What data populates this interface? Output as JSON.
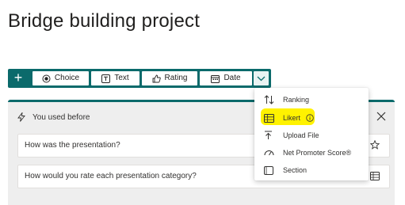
{
  "page": {
    "title": "Bridge building project"
  },
  "toolbar": {
    "add_label": "+",
    "choice_label": "Choice",
    "text_label": "Text",
    "rating_label": "Rating",
    "date_label": "Date"
  },
  "card": {
    "used_before_label": "You used before",
    "questions": [
      "How was the presentation?",
      "How would you rate each presentation category?"
    ]
  },
  "menu": {
    "items": [
      "Ranking",
      "Likert",
      "Upload File",
      "Net Promoter Score®",
      "Section"
    ],
    "highlighted_item": "Likert"
  },
  "colors": {
    "accent": "#0b6a6b",
    "highlight": "#fff200",
    "card_background": "#eeeeee"
  }
}
